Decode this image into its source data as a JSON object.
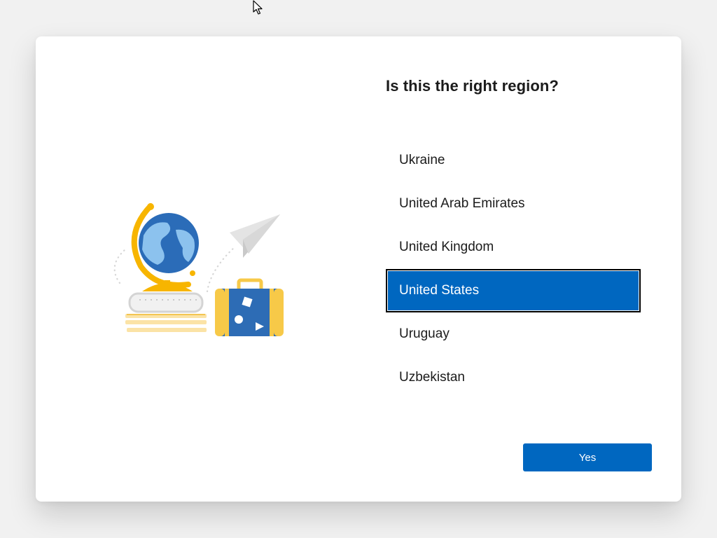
{
  "dialog": {
    "title": "Is this the right region?",
    "regions": [
      {
        "label": "Ukraine",
        "selected": false
      },
      {
        "label": "United Arab Emirates",
        "selected": false
      },
      {
        "label": "United Kingdom",
        "selected": false
      },
      {
        "label": "United States",
        "selected": true
      },
      {
        "label": "Uruguay",
        "selected": false
      },
      {
        "label": "Uzbekistan",
        "selected": false
      }
    ],
    "yes_label": "Yes"
  },
  "icons": {
    "cursor": "mouse-pointer-icon",
    "illustration": "globe-books-suitcase-paper-plane-illustration"
  },
  "colors": {
    "accent": "#0067c0",
    "background": "#f1f1f1",
    "card": "#ffffff",
    "text": "#1b1b1b"
  }
}
